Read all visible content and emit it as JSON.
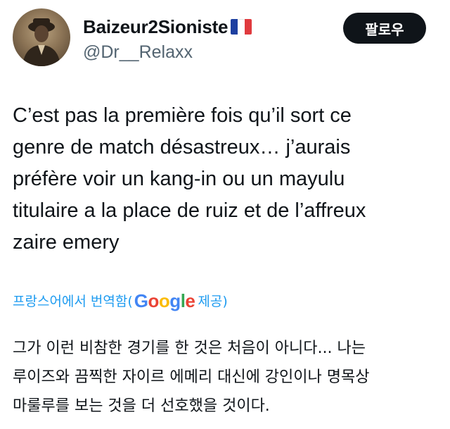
{
  "user": {
    "display_name": "Baizeur2Sioniste",
    "flag_icon": "france-flag-icon",
    "flag_colors": [
      "#1d3fa0",
      "#ffffff",
      "#e03a3e"
    ],
    "handle": "@Dr__Relaxx"
  },
  "follow_button": {
    "label": "팔로우"
  },
  "tweet": {
    "text": "C’est pas la première fois qu’il sort ce\ngenre de match désastreux… j’aurais\npréfère voir un kang-in ou un mayulu\ntitulaire a la place de ruiz et de l’affreux\nzaire emery"
  },
  "translation": {
    "prefix": "프랑스어에서 번역함(",
    "provider_letters": [
      "G",
      "o",
      "o",
      "g",
      "l",
      "e"
    ],
    "suffix": " 제공)",
    "text": "그가 이런 비참한 경기를 한 것은 처음이 아니다... 나는\n루이즈와 끔찍한 자이르 에메리 대신에 강인이나 명목상\n마룰루를 보는 것을 더 선호했을 것이다."
  },
  "colors": {
    "link_blue": "#1d9bf0",
    "secondary_gray": "#536471",
    "text_black": "#0f1419"
  }
}
